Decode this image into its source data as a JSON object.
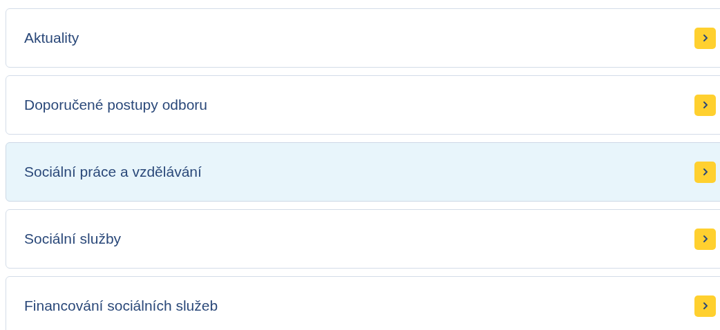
{
  "items": [
    {
      "label": "Aktuality",
      "selected": false
    },
    {
      "label": "Doporučené postupy odboru",
      "selected": false
    },
    {
      "label": "Sociální práce a vzdělávání",
      "selected": true
    },
    {
      "label": "Sociální služby",
      "selected": false
    },
    {
      "label": "Financování sociálních služeb",
      "selected": false
    }
  ]
}
